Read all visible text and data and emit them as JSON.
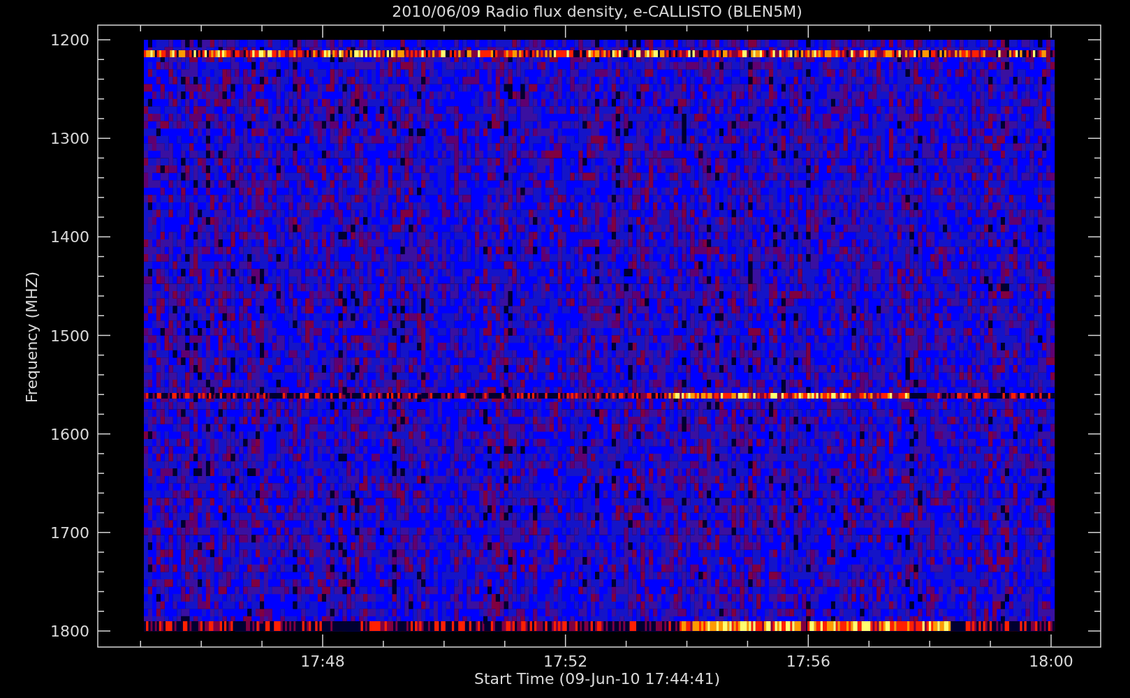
{
  "title": "2010/06/09  Radio flux density, e-CALLISTO (BLEN5M)",
  "y_axis": {
    "title": "Frequency (MHZ)",
    "tick_labels": [
      "1200",
      "1300",
      "1400",
      "1500",
      "1600",
      "1700",
      "1800"
    ]
  },
  "x_axis": {
    "title": "Start Time (09-Jun-10 17:44:41)",
    "tick_labels": [
      "17:48",
      "17:52",
      "17:56",
      "18:00"
    ]
  }
}
